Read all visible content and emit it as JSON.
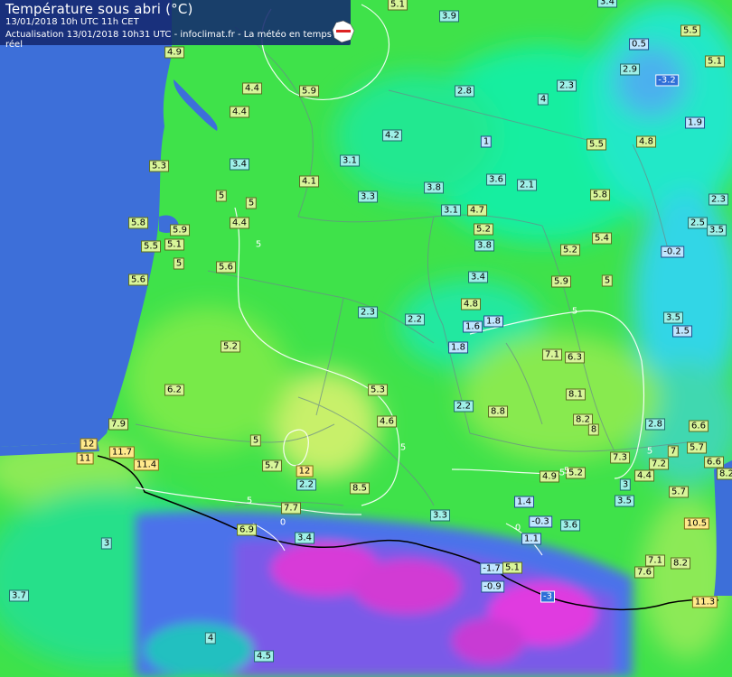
{
  "header": {
    "title": "Température sous abri (°C)",
    "timestamp": "13/01/2018  10h UTC  11h CET",
    "update": "Actualisation 13/01/2018 10h31 UTC - infoclimat.fr - La météo en temps réel"
  },
  "logo": {
    "name": "infoclimat-logo",
    "text": "INFO CLIMAT"
  },
  "colors": {
    "ocean": "#3d6fd9",
    "land_green": "#3fe24a",
    "land_light": "#b8f06a",
    "land_cool": "#19f0b0",
    "mountain_blue": "#5a6ee8",
    "mountain_magenta": "#e62ad8",
    "header_bg": "#142872"
  },
  "stations": [
    {
      "v": "5.1",
      "c": "warm"
    },
    {
      "v": "3.9",
      "c": "cool"
    },
    {
      "v": "3.4",
      "c": "cool"
    },
    {
      "v": "5.5",
      "c": "warm"
    },
    {
      "v": "4.9",
      "c": "warm"
    },
    {
      "v": "0.5",
      "c": "cold"
    },
    {
      "v": "5.1",
      "c": "warm"
    },
    {
      "v": "2.9",
      "c": "cool"
    },
    {
      "v": "-3.2",
      "c": "neg"
    },
    {
      "v": "4.4",
      "c": "warm"
    },
    {
      "v": "5.9",
      "c": "warm"
    },
    {
      "v": "2.8",
      "c": "cool"
    },
    {
      "v": "2.3",
      "c": "cool"
    },
    {
      "v": "4",
      "c": "cool"
    },
    {
      "v": "4.4",
      "c": "warm"
    },
    {
      "v": "1.9",
      "c": "cold"
    },
    {
      "v": "4.2",
      "c": "cool"
    },
    {
      "v": "1",
      "c": "cold"
    },
    {
      "v": "5.5",
      "c": "warm"
    },
    {
      "v": "4.8",
      "c": "warm"
    },
    {
      "v": "5.3",
      "c": "warm"
    },
    {
      "v": "3.4",
      "c": "cool"
    },
    {
      "v": "3.1",
      "c": "cool"
    },
    {
      "v": "4.1",
      "c": "warm"
    },
    {
      "v": "3.6",
      "c": "cool"
    },
    {
      "v": "2.1",
      "c": "cool"
    },
    {
      "v": "5",
      "c": "warm"
    },
    {
      "v": "5",
      "c": "warm"
    },
    {
      "v": "3.3",
      "c": "cool"
    },
    {
      "v": "3.8",
      "c": "cool"
    },
    {
      "v": "5.8",
      "c": "warm"
    },
    {
      "v": "2.3",
      "c": "cool"
    },
    {
      "v": "3.1",
      "c": "cool"
    },
    {
      "v": "4.7",
      "c": "warm"
    },
    {
      "v": "5.8",
      "c": "warm"
    },
    {
      "v": "4.4",
      "c": "warm"
    },
    {
      "v": "5.9",
      "c": "warm"
    },
    {
      "v": "5.2",
      "c": "warm"
    },
    {
      "v": "2.5",
      "c": "cool"
    },
    {
      "v": "3.5",
      "c": "cool"
    },
    {
      "v": "5.5",
      "c": "warm"
    },
    {
      "v": "5.1",
      "c": "warm"
    },
    {
      "v": "3.8",
      "c": "cool"
    },
    {
      "v": "5.4",
      "c": "warm"
    },
    {
      "v": "5.2",
      "c": "warm"
    },
    {
      "v": "-0.2",
      "c": "cold"
    },
    {
      "v": "5",
      "c": "warm"
    },
    {
      "v": "5.6",
      "c": "warm"
    },
    {
      "v": "3.4",
      "c": "cool"
    },
    {
      "v": "5.6",
      "c": "warm"
    },
    {
      "v": "5.9",
      "c": "warm"
    },
    {
      "v": "5",
      "c": "warm"
    },
    {
      "v": "4.8",
      "c": "warm"
    },
    {
      "v": "2.3",
      "c": "cool"
    },
    {
      "v": "2.2",
      "c": "cool"
    },
    {
      "v": "1.6",
      "c": "cold"
    },
    {
      "v": "1.8",
      "c": "cold"
    },
    {
      "v": "3.5",
      "c": "cool"
    },
    {
      "v": "1.5",
      "c": "cold"
    },
    {
      "v": "5.2",
      "c": "warm"
    },
    {
      "v": "1.8",
      "c": "cold"
    },
    {
      "v": "7.1",
      "c": "warm"
    },
    {
      "v": "6.3",
      "c": "warm"
    },
    {
      "v": "6.2",
      "c": "warm"
    },
    {
      "v": "5.3",
      "c": "warm"
    },
    {
      "v": "8.1",
      "c": "warm"
    },
    {
      "v": "2.2",
      "c": "cool"
    },
    {
      "v": "8.8",
      "c": "warm"
    },
    {
      "v": "4.6",
      "c": "warm"
    },
    {
      "v": "8.2",
      "c": "warm"
    },
    {
      "v": "8",
      "c": "warm"
    },
    {
      "v": "2.8",
      "c": "cool"
    },
    {
      "v": "6.6",
      "c": "warm"
    },
    {
      "v": "7.9",
      "c": "warm"
    },
    {
      "v": "5",
      "c": "warm"
    },
    {
      "v": "5.7",
      "c": "warm"
    },
    {
      "v": "12",
      "c": "hot"
    },
    {
      "v": "11.7",
      "c": "hot"
    },
    {
      "v": "7.3",
      "c": "warm"
    },
    {
      "v": "7",
      "c": "warm"
    },
    {
      "v": "6.6",
      "c": "warm"
    },
    {
      "v": "8.2",
      "c": "warm"
    },
    {
      "v": "11",
      "c": "hot"
    },
    {
      "v": "11.4",
      "c": "hot"
    },
    {
      "v": "7.2",
      "c": "warm"
    },
    {
      "v": "5.7",
      "c": "warm"
    },
    {
      "v": "12",
      "c": "hot"
    },
    {
      "v": "4.9",
      "c": "warm"
    },
    {
      "v": "5.2",
      "c": "warm"
    },
    {
      "v": "4.4",
      "c": "warm"
    },
    {
      "v": "2.2",
      "c": "cool"
    },
    {
      "v": "8.5",
      "c": "warm"
    },
    {
      "v": "3",
      "c": "cool"
    },
    {
      "v": "5.7",
      "c": "warm"
    },
    {
      "v": "1.4",
      "c": "cold"
    },
    {
      "v": "3.5",
      "c": "cool"
    },
    {
      "v": "7.7",
      "c": "warm"
    },
    {
      "v": "3.3",
      "c": "cool"
    },
    {
      "v": "10.5",
      "c": "hot"
    },
    {
      "v": "6.9",
      "c": "warm"
    },
    {
      "v": "-0.3",
      "c": "cold"
    },
    {
      "v": "3.6",
      "c": "cool"
    },
    {
      "v": "3.4",
      "c": "cool"
    },
    {
      "v": "1.1",
      "c": "cold"
    },
    {
      "v": "3",
      "c": "cool"
    },
    {
      "v": "7.1",
      "c": "warm"
    },
    {
      "v": "8.2",
      "c": "warm"
    },
    {
      "v": "-1.7",
      "c": "cold"
    },
    {
      "v": "5.1",
      "c": "warm"
    },
    {
      "v": "7.6",
      "c": "warm"
    },
    {
      "v": "-0.9",
      "c": "cold"
    },
    {
      "v": "3.7",
      "c": "cool"
    },
    {
      "v": "-3",
      "c": "neg"
    },
    {
      "v": "11.3",
      "c": "hot"
    },
    {
      "v": "4",
      "c": "cool"
    },
    {
      "v": "4.5",
      "c": "cool"
    }
  ],
  "contours": [
    "5",
    "5",
    "5",
    "5",
    "5",
    "5",
    "5",
    "0",
    "0"
  ]
}
